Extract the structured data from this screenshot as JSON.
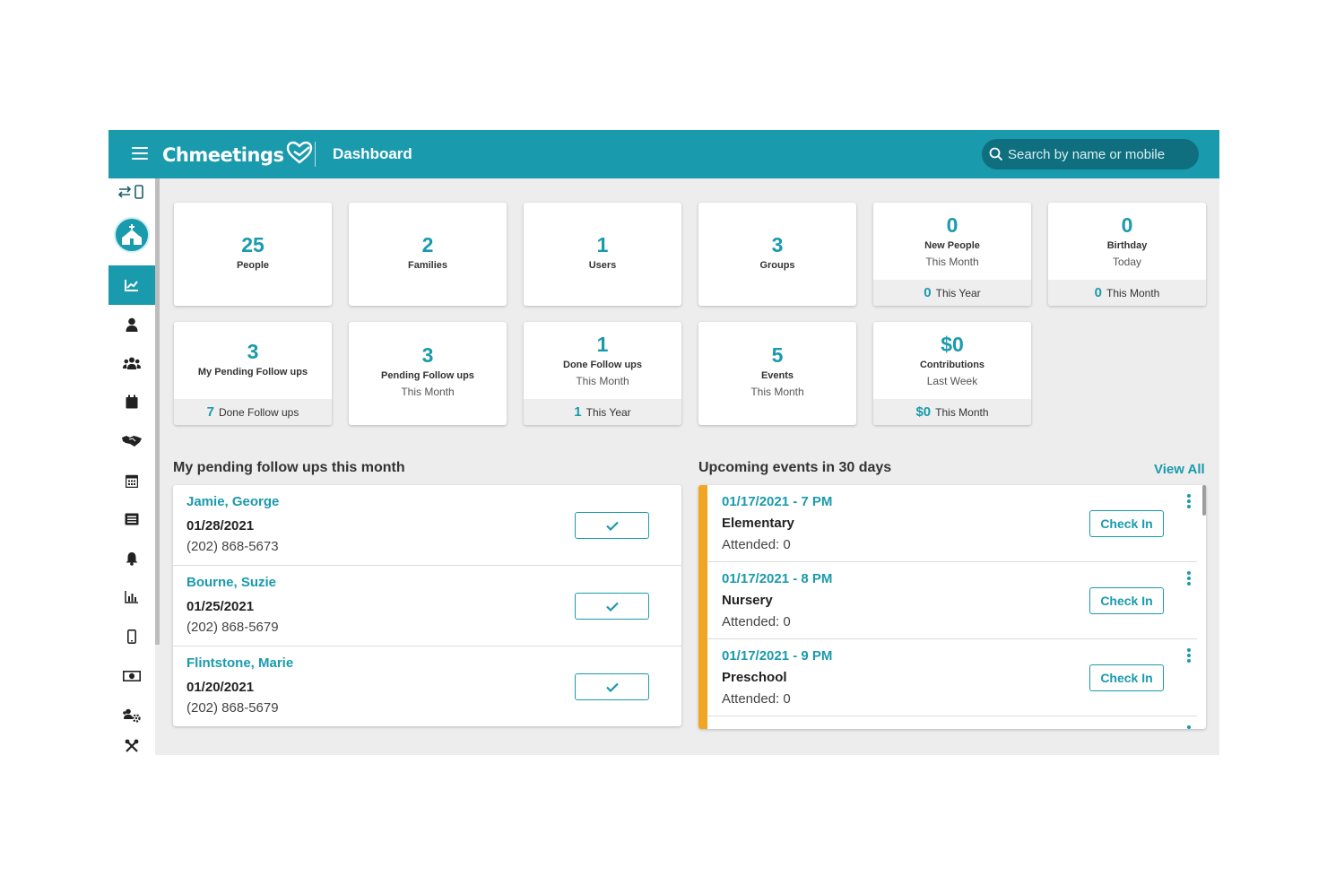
{
  "header": {
    "logo_text": "Chmeetings",
    "page_title": "Dashboard",
    "search_placeholder": "Search by name or mobile"
  },
  "colors": {
    "primary": "#1a9aad",
    "accent": "#f0a623",
    "background": "#ededed"
  },
  "sidebar": {
    "items": [
      {
        "icon": "switch-device-icon"
      },
      {
        "icon": "church-icon"
      },
      {
        "icon": "dashboard-chart-icon",
        "active": true
      },
      {
        "icon": "person-icon"
      },
      {
        "icon": "people-group-icon"
      },
      {
        "icon": "calendar-icon"
      },
      {
        "icon": "handshake-icon"
      },
      {
        "icon": "calendar-grid-icon"
      },
      {
        "icon": "list-icon"
      },
      {
        "icon": "bell-icon"
      },
      {
        "icon": "bar-chart-icon"
      },
      {
        "icon": "mobile-icon"
      },
      {
        "icon": "money-icon"
      },
      {
        "icon": "team-settings-icon"
      },
      {
        "icon": "tools-icon"
      }
    ]
  },
  "stats": {
    "people": {
      "value": "25",
      "label": "People"
    },
    "families": {
      "value": "2",
      "label": "Families"
    },
    "users": {
      "value": "1",
      "label": "Users"
    },
    "groups": {
      "value": "3",
      "label": "Groups"
    },
    "new_people": {
      "value": "0",
      "label": "New People",
      "sub": "This Month",
      "foot_value": "0",
      "foot_label": "This Year"
    },
    "birthday": {
      "value": "0",
      "label": "Birthday",
      "sub": "Today",
      "foot_value": "0",
      "foot_label": "This Month"
    },
    "my_pending": {
      "value": "3",
      "label": "My Pending Follow ups",
      "foot_value": "7",
      "foot_label": "Done Follow ups"
    },
    "pending": {
      "value": "3",
      "label": "Pending Follow ups",
      "sub": "This Month"
    },
    "done": {
      "value": "1",
      "label": "Done Follow ups",
      "sub": "This Month",
      "foot_value": "1",
      "foot_label": "This Year"
    },
    "events": {
      "value": "5",
      "label": "Events",
      "sub": "This Month"
    },
    "contributions": {
      "value": "$0",
      "label": "Contributions",
      "sub": "Last Week",
      "foot_value": "$0",
      "foot_label": "This Month"
    }
  },
  "followups": {
    "title": "My pending follow ups this month",
    "items": [
      {
        "name": "Jamie, George",
        "date": "01/28/2021",
        "phone": "(202) 868-5673"
      },
      {
        "name": "Bourne, Suzie",
        "date": "01/25/2021",
        "phone": "(202) 868-5679"
      },
      {
        "name": "Flintstone, Marie",
        "date": "01/20/2021",
        "phone": "(202) 868-5679"
      }
    ]
  },
  "events": {
    "title": "Upcoming events in 30 days",
    "view_all": "View All",
    "checkin_label": "Check In",
    "items": [
      {
        "time": "01/17/2021 - 7 PM",
        "name": "Elementary",
        "attended": "Attended: 0"
      },
      {
        "time": "01/17/2021 - 8 PM",
        "name": "Nursery",
        "attended": "Attended: 0"
      },
      {
        "time": "01/17/2021 - 9 PM",
        "name": "Preschool",
        "attended": "Attended: 0"
      }
    ]
  }
}
